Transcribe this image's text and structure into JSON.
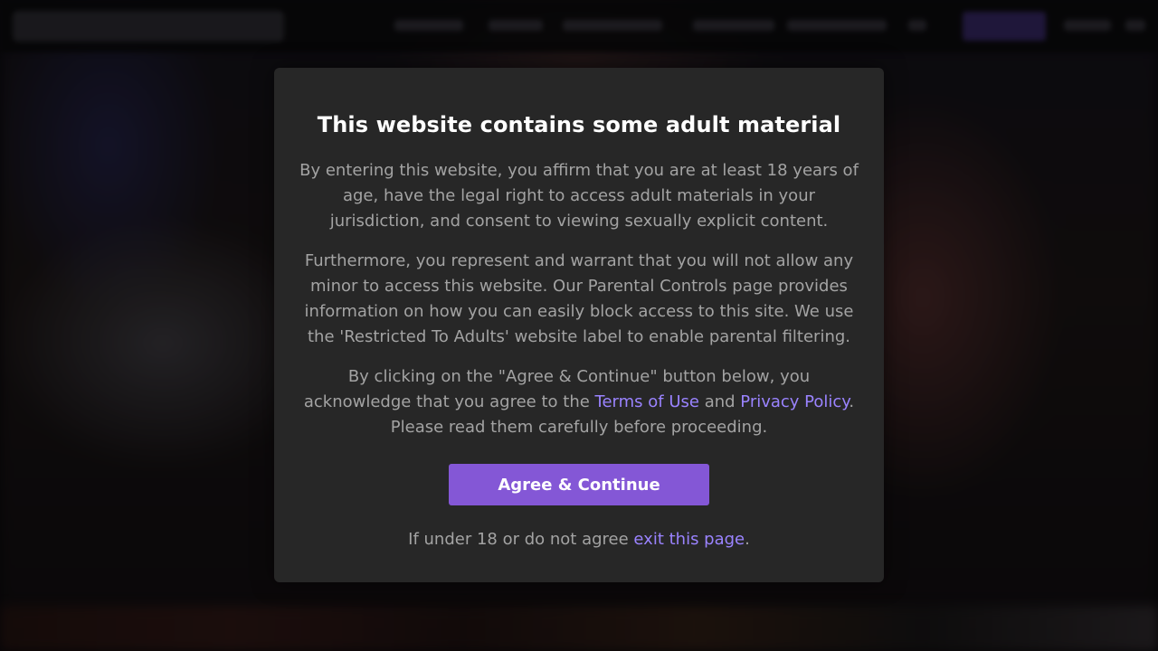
{
  "modal": {
    "title": "This website contains some adult material",
    "paragraph1": "By entering this website, you affirm that you are at least 18 years of age, have the legal right to access adult materials in your jurisdiction, and consent to viewing sexually explicit content.",
    "paragraph2": "Furthermore, you represent and warrant that you will not allow any minor to access this website. Our Parental Controls page provides information on how you can easily block access to this site. We use the 'Restricted To Adults' website label to enable parental filtering.",
    "paragraph3": {
      "before": "By clicking on the \"Agree & Continue\" button below, you acknowledge that you agree to the ",
      "terms_link": "Terms of Use",
      "middle": " and ",
      "privacy_link": "Privacy Policy",
      "after": ". Please read them carefully before proceeding."
    },
    "agree_button": "Agree & Continue",
    "footer": {
      "before": "If under 18 or do not agree ",
      "exit_link": "exit this page",
      "after": "."
    }
  },
  "colors": {
    "accent": "#8457d6",
    "link": "#9a83ff",
    "modal_bg": "#272727",
    "body_text": "#a3a3a3",
    "title_text": "#ffffff"
  }
}
